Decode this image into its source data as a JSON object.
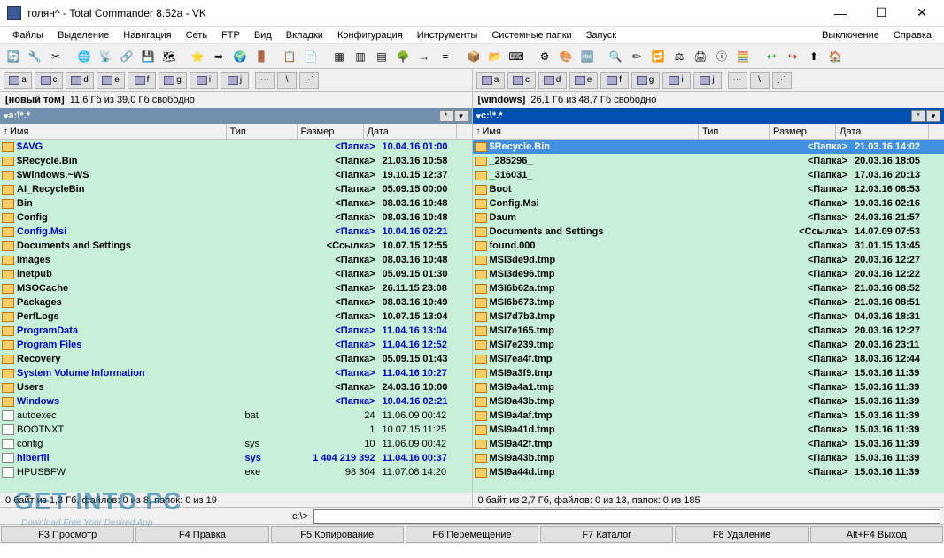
{
  "title": "толян^ - Total Commander 8.52a - VK",
  "menu": [
    "Файлы",
    "Выделение",
    "Навигация",
    "Сеть",
    "FTP",
    "Вид",
    "Вкладки",
    "Конфигурация",
    "Инструменты",
    "Системные папки",
    "Запуск"
  ],
  "menu_right": [
    "Выключение",
    "Справка"
  ],
  "drives": [
    "a",
    "c",
    "d",
    "e",
    "f",
    "g",
    "i",
    "j"
  ],
  "drive_extra": [
    "⋯",
    "\\",
    "⋰"
  ],
  "left": {
    "info_vol": "[новый том]",
    "info_free": "11,6 Гб из 39,0 Гб свободно",
    "path": "a:\\*.*",
    "headers": {
      "name": "Имя",
      "type": "Тип",
      "size": "Размер",
      "date": "Дата"
    },
    "rows": [
      {
        "n": "$AVG",
        "t": "",
        "s": "<Папка>",
        "d": "10.04.16 01:00",
        "cls": "blue-text",
        "ic": "folder"
      },
      {
        "n": "$Recycle.Bin",
        "t": "",
        "s": "<Папка>",
        "d": "21.03.16 10:58",
        "cls": "bold-text",
        "ic": "folder"
      },
      {
        "n": "$Windows.~WS",
        "t": "",
        "s": "<Папка>",
        "d": "19.10.15 12:37",
        "cls": "bold-text",
        "ic": "folder"
      },
      {
        "n": "AI_RecycleBin",
        "t": "",
        "s": "<Папка>",
        "d": "05.09.15 00:00",
        "cls": "bold-text",
        "ic": "folder"
      },
      {
        "n": "Bin",
        "t": "",
        "s": "<Папка>",
        "d": "08.03.16 10:48",
        "cls": "bold-text",
        "ic": "folder"
      },
      {
        "n": "Config",
        "t": "",
        "s": "<Папка>",
        "d": "08.03.16 10:48",
        "cls": "bold-text",
        "ic": "folder"
      },
      {
        "n": "Config.Msi",
        "t": "",
        "s": "<Папка>",
        "d": "10.04.16 02:21",
        "cls": "blue-text",
        "ic": "folder"
      },
      {
        "n": "Documents and Settings",
        "t": "",
        "s": "<Ссылка>",
        "d": "10.07.15 12:55",
        "cls": "bold-text",
        "ic": "folder"
      },
      {
        "n": "Images",
        "t": "",
        "s": "<Папка>",
        "d": "08.03.16 10:48",
        "cls": "bold-text",
        "ic": "folder"
      },
      {
        "n": "inetpub",
        "t": "",
        "s": "<Папка>",
        "d": "05.09.15 01:30",
        "cls": "bold-text",
        "ic": "folder"
      },
      {
        "n": "MSOCache",
        "t": "",
        "s": "<Папка>",
        "d": "26.11.15 23:08",
        "cls": "bold-text",
        "ic": "folder"
      },
      {
        "n": "Packages",
        "t": "",
        "s": "<Папка>",
        "d": "08.03.16 10:49",
        "cls": "bold-text",
        "ic": "folder"
      },
      {
        "n": "PerfLogs",
        "t": "",
        "s": "<Папка>",
        "d": "10.07.15 13:04",
        "cls": "bold-text",
        "ic": "folder"
      },
      {
        "n": "ProgramData",
        "t": "",
        "s": "<Папка>",
        "d": "11.04.16 13:04",
        "cls": "blue-text",
        "ic": "folder"
      },
      {
        "n": "Program Files",
        "t": "",
        "s": "<Папка>",
        "d": "11.04.16 12:52",
        "cls": "blue-text",
        "ic": "folder"
      },
      {
        "n": "Recovery",
        "t": "",
        "s": "<Папка>",
        "d": "05.09.15 01:43",
        "cls": "bold-text",
        "ic": "folder"
      },
      {
        "n": "System Volume Information",
        "t": "",
        "s": "<Папка>",
        "d": "11.04.16 10:27",
        "cls": "blue-text",
        "ic": "folder"
      },
      {
        "n": "Users",
        "t": "",
        "s": "<Папка>",
        "d": "24.03.16 10:00",
        "cls": "bold-text",
        "ic": "folder"
      },
      {
        "n": "Windows",
        "t": "",
        "s": "<Папка>",
        "d": "10.04.16 02:21",
        "cls": "blue-text",
        "ic": "folder"
      },
      {
        "n": "autoexec",
        "t": "bat",
        "s": "24",
        "d": "11.06.09 00:42",
        "cls": "",
        "ic": "file"
      },
      {
        "n": "BOOTNXT",
        "t": "",
        "s": "1",
        "d": "10.07.15 11:25",
        "cls": "",
        "ic": "file"
      },
      {
        "n": "config",
        "t": "sys",
        "s": "10",
        "d": "11.06.09 00:42",
        "cls": "",
        "ic": "file"
      },
      {
        "n": "hiberfil",
        "t": "sys",
        "s": "1 404 219 392",
        "d": "11.04.16 00:37",
        "cls": "blue-text",
        "ic": "file"
      },
      {
        "n": "HPUSBFW",
        "t": "exe",
        "s": "98 304",
        "d": "11.07.08 14:20",
        "cls": "",
        "ic": "file"
      }
    ],
    "status": "0 байт из 1,3 Гб, файлов: 0 из 8, папок: 0 из 19"
  },
  "right": {
    "info_vol": "[windows]",
    "info_free": "26,1 Гб из 48,7 Гб свободно",
    "path": "c:\\*.*",
    "headers": {
      "name": "Имя",
      "type": "Тип",
      "size": "Размер",
      "date": "Дата"
    },
    "rows": [
      {
        "n": "$Recycle.Bin",
        "t": "",
        "s": "<Папка>",
        "d": "21.03.16 14:02",
        "cls": "bold-text",
        "ic": "folder",
        "sel": true
      },
      {
        "n": "_285296_",
        "t": "",
        "s": "<Папка>",
        "d": "20.03.16 18:05",
        "cls": "bold-text",
        "ic": "folder"
      },
      {
        "n": "_316031_",
        "t": "",
        "s": "<Папка>",
        "d": "17.03.16 20:13",
        "cls": "bold-text",
        "ic": "folder"
      },
      {
        "n": "Boot",
        "t": "",
        "s": "<Папка>",
        "d": "12.03.16 08:53",
        "cls": "bold-text",
        "ic": "folder"
      },
      {
        "n": "Config.Msi",
        "t": "",
        "s": "<Папка>",
        "d": "19.03.16 02:16",
        "cls": "bold-text",
        "ic": "folder"
      },
      {
        "n": "Daum",
        "t": "",
        "s": "<Папка>",
        "d": "24.03.16 21:57",
        "cls": "bold-text",
        "ic": "folder"
      },
      {
        "n": "Documents and Settings",
        "t": "",
        "s": "<Ссылка>",
        "d": "14.07.09 07:53",
        "cls": "bold-text",
        "ic": "folder"
      },
      {
        "n": "found.000",
        "t": "",
        "s": "<Папка>",
        "d": "31.01.15 13:45",
        "cls": "bold-text",
        "ic": "folder"
      },
      {
        "n": "MSI3de9d.tmp",
        "t": "",
        "s": "<Папка>",
        "d": "20.03.16 12:27",
        "cls": "bold-text",
        "ic": "folder"
      },
      {
        "n": "MSI3de96.tmp",
        "t": "",
        "s": "<Папка>",
        "d": "20.03.16 12:22",
        "cls": "bold-text",
        "ic": "folder"
      },
      {
        "n": "MSI6b62a.tmp",
        "t": "",
        "s": "<Папка>",
        "d": "21.03.16 08:52",
        "cls": "bold-text",
        "ic": "folder"
      },
      {
        "n": "MSI6b673.tmp",
        "t": "",
        "s": "<Папка>",
        "d": "21.03.16 08:51",
        "cls": "bold-text",
        "ic": "folder"
      },
      {
        "n": "MSI7d7b3.tmp",
        "t": "",
        "s": "<Папка>",
        "d": "04.03.16 18:31",
        "cls": "bold-text",
        "ic": "folder"
      },
      {
        "n": "MSI7e165.tmp",
        "t": "",
        "s": "<Папка>",
        "d": "20.03.16 12:27",
        "cls": "bold-text",
        "ic": "folder"
      },
      {
        "n": "MSI7e239.tmp",
        "t": "",
        "s": "<Папка>",
        "d": "20.03.16 23:11",
        "cls": "bold-text",
        "ic": "folder"
      },
      {
        "n": "MSI7ea4f.tmp",
        "t": "",
        "s": "<Папка>",
        "d": "18.03.16 12:44",
        "cls": "bold-text",
        "ic": "folder"
      },
      {
        "n": "MSI9a3f9.tmp",
        "t": "",
        "s": "<Папка>",
        "d": "15.03.16 11:39",
        "cls": "bold-text",
        "ic": "folder"
      },
      {
        "n": "MSI9a4a1.tmp",
        "t": "",
        "s": "<Папка>",
        "d": "15.03.16 11:39",
        "cls": "bold-text",
        "ic": "folder"
      },
      {
        "n": "MSI9a43b.tmp",
        "t": "",
        "s": "<Папка>",
        "d": "15.03.16 11:39",
        "cls": "bold-text",
        "ic": "folder"
      },
      {
        "n": "MSI9a4af.tmp",
        "t": "",
        "s": "<Папка>",
        "d": "15.03.16 11:39",
        "cls": "bold-text",
        "ic": "folder"
      },
      {
        "n": "MSI9a41d.tmp",
        "t": "",
        "s": "<Папка>",
        "d": "15.03.16 11:39",
        "cls": "bold-text",
        "ic": "folder"
      },
      {
        "n": "MSI9a42f.tmp",
        "t": "",
        "s": "<Папка>",
        "d": "15.03.16 11:39",
        "cls": "bold-text",
        "ic": "folder"
      },
      {
        "n": "MSI9a43b.tmp",
        "t": "",
        "s": "<Папка>",
        "d": "15.03.16 11:39",
        "cls": "bold-text",
        "ic": "folder"
      },
      {
        "n": "MSI9a44d.tmp",
        "t": "",
        "s": "<Папка>",
        "d": "15.03.16 11:39",
        "cls": "bold-text",
        "ic": "folder"
      }
    ],
    "status": "0 байт из 2,7 Гб, файлов: 0 из 13, папок: 0 из 185"
  },
  "cmd_label": "c:\\>",
  "fkeys": [
    "F3 Просмотр",
    "F4 Правка",
    "F5 Копирование",
    "F6 Перемещение",
    "F7 Каталог",
    "F8 Удаление",
    "Alt+F4 Выход"
  ],
  "watermark": "GET INTO PC",
  "watermark2": "Download Free Your Desired App"
}
